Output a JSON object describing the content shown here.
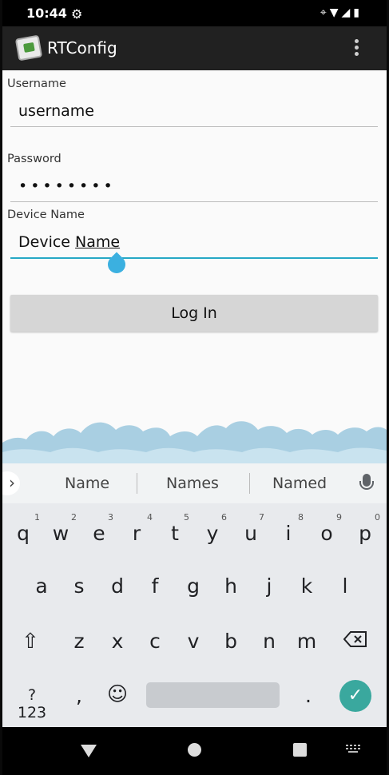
{
  "status": {
    "time": "10:44"
  },
  "app": {
    "title": "RTConfig"
  },
  "form": {
    "username_label": "Username",
    "username_value": "username",
    "password_label": "Password",
    "password_value": "••••••••",
    "device_label": "Device Name",
    "device_value_prefix": "Device ",
    "device_value_composing": "Name",
    "login_label": "Log In"
  },
  "keyboard": {
    "suggestions": [
      "Name",
      "Names",
      "Named"
    ],
    "row1": [
      "q",
      "w",
      "e",
      "r",
      "t",
      "y",
      "u",
      "i",
      "o",
      "p"
    ],
    "row1_hints": [
      "1",
      "2",
      "3",
      "4",
      "5",
      "6",
      "7",
      "8",
      "9",
      "0"
    ],
    "row2": [
      "a",
      "s",
      "d",
      "f",
      "g",
      "h",
      "j",
      "k",
      "l"
    ],
    "row3": [
      "z",
      "x",
      "c",
      "v",
      "b",
      "n",
      "m"
    ],
    "symbols_label": "?123",
    "comma_label": ",",
    "period_label": ".",
    "emoji": "☺",
    "enter_glyph": "✓"
  },
  "colors": {
    "accent": "#26a8c5",
    "enter": "#3aa89e",
    "cloud": "#a9cfe2"
  }
}
